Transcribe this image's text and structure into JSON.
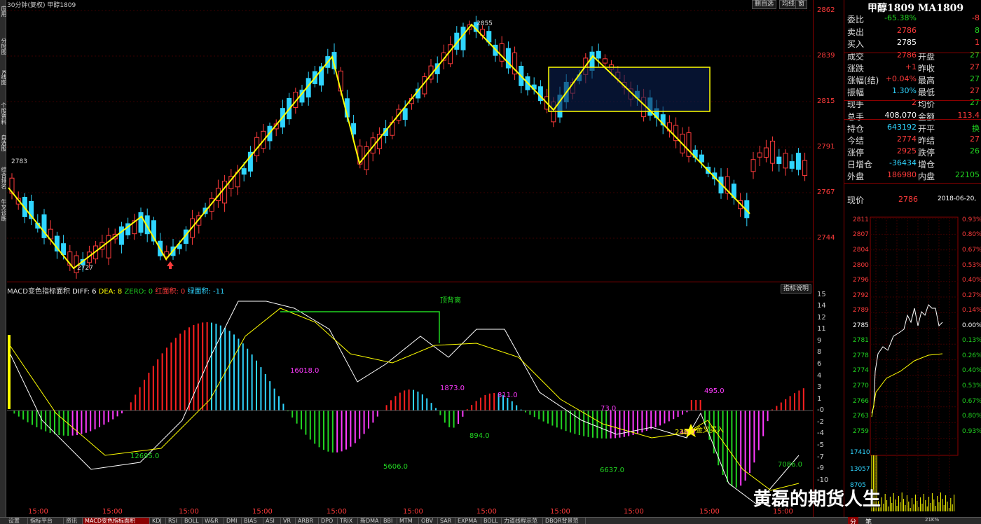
{
  "header": {
    "title": "30分钟(复权)  甲醇1809",
    "buttons": [
      "删自选",
      "均线",
      "窗"
    ]
  },
  "left_tabs": [
    "应用",
    "分时图",
    "K线图",
    "个股资料",
    "自选股",
    "综合排名",
    "牛叉诊断"
  ],
  "price_axis": [
    "2862",
    "2839",
    "2815",
    "2791",
    "2767",
    "2744"
  ],
  "x_labels": [
    "15:00",
    "15:00",
    "15:00",
    "15:00",
    "15:00",
    "15:00",
    "15:00",
    "15:00",
    "15:00",
    "15:00",
    "15:00"
  ],
  "kline_labels": {
    "high_left": "2783",
    "low_left": "2727",
    "top": "2855"
  },
  "macd": {
    "header": "MACD变色指标面积",
    "diff": "DIFF: 6",
    "dea": "DEA: 8",
    "zero": "ZERO: 0",
    "red_area": "红面积: 0",
    "green_area": "绿面积: -11",
    "help": "指标说明",
    "axis": [
      "15",
      "14",
      "12",
      "11",
      "9",
      "8",
      "6",
      "4",
      "3",
      "1",
      "-0",
      "-2",
      "-4",
      "-5",
      "-7",
      "-9",
      "-10"
    ],
    "annotations": {
      "top_div": "顶背离",
      "a16018": "16018.0",
      "a1873": "1873.0",
      "a811": "811.0",
      "a495": "495.0",
      "a12695": "12695.0",
      "a5606": "5606.0",
      "a894": "894.0",
      "a6637": "6637.0",
      "a7086": "7086.0",
      "a73": "73.0",
      "a46": "46.0",
      "a2380": "2380",
      "buy": "金叉买入"
    }
  },
  "quote": {
    "title": "甲醇1809 MA1809",
    "rows": [
      {
        "l": "委比",
        "v": "-65.38%",
        "c": "grn",
        "l2": "",
        "v2": "-8"
      },
      {
        "l": "卖出",
        "v": "2786",
        "c": "red",
        "l2": "",
        "v2": "8"
      },
      {
        "l": "买入",
        "v": "2785",
        "c": "wh",
        "l2": "",
        "v2": "1"
      },
      {
        "l": "成交",
        "v": "2786",
        "c": "red",
        "l2": "开盘",
        "v2": "27"
      },
      {
        "l": "涨跌",
        "v": "+1",
        "c": "red",
        "l2": "昨收",
        "v2": "27"
      },
      {
        "l": "涨幅(结)",
        "v": "+0.04%",
        "c": "red",
        "l2": "最高",
        "v2": "27"
      },
      {
        "l": "振幅",
        "v": "1.30%",
        "c": "cyan",
        "l2": "最低",
        "v2": "27"
      },
      {
        "l": "现手",
        "v": "2",
        "c": "red",
        "l2": "均价",
        "v2": "27"
      },
      {
        "l": "总手",
        "v": "408,070",
        "c": "wh",
        "l2": "金额",
        "v2": "113.4"
      },
      {
        "l": "持仓",
        "v": "643192",
        "c": "cyan",
        "l2": "开平",
        "v2": "换"
      },
      {
        "l": "今结",
        "v": "2774",
        "c": "red",
        "l2": "昨结",
        "v2": "27"
      },
      {
        "l": "涨停",
        "v": "2925",
        "c": "red",
        "l2": "跌停",
        "v2": "26"
      },
      {
        "l": "日增仓",
        "v": "-36434",
        "c": "cyan",
        "l2": "增仓",
        "v2": ""
      },
      {
        "l": "外盘",
        "v": "186980",
        "c": "red",
        "l2": "内盘",
        "v2": "22105"
      }
    ],
    "current_label": "现价",
    "current_value": "2786",
    "date": "2018-06-20,"
  },
  "intraday": {
    "price_axis": [
      "2811",
      "2807",
      "2804",
      "2800",
      "2796",
      "2792",
      "2789",
      "2785",
      "2781",
      "2778",
      "2774",
      "2770",
      "2766",
      "2763",
      "2759"
    ],
    "pct_axis": [
      "0.93%",
      "0.80%",
      "0.67%",
      "0.53%",
      "0.40%",
      "0.27%",
      "0.14%",
      "0.00%",
      "0.13%",
      "0.26%",
      "0.40%",
      "0.53%",
      "0.67%",
      "0.80%",
      "0.93%"
    ],
    "vol_axis": [
      "17410",
      "13057",
      "8705"
    ],
    "bottom": [
      "分",
      "笔"
    ],
    "vol_unit": "21K%"
  },
  "bottom_tabs": [
    "设置",
    "指标平台",
    "资讯",
    "MACD变色指标面积",
    "KDJ",
    "RSI",
    "BOLL",
    "W&R",
    "DMI",
    "BIAS",
    "ASI",
    "VR",
    "ARBR",
    "DPO",
    "TRIX",
    "新DMA",
    "BBI",
    "MTM",
    "OBV",
    "SAR",
    "EXPMA",
    "BOLL",
    "力道线程示范",
    "DBQR背景范"
  ],
  "watermark": "黄磊的期货人生",
  "colors": {
    "up": "#ff3b3b",
    "down": "#2fd5ff",
    "zig": "#ffff00",
    "box": "#ffff00",
    "boxfill": "#0a2050"
  }
}
